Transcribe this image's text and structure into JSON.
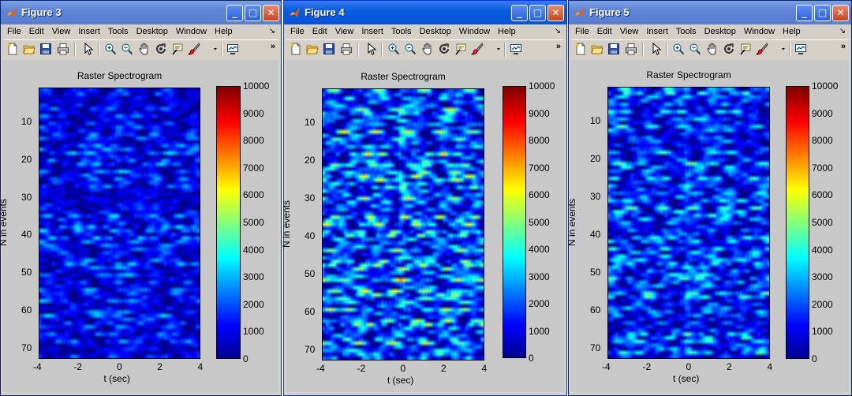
{
  "menu": [
    "File",
    "Edit",
    "View",
    "Insert",
    "Tools",
    "Desktop",
    "Window",
    "Help"
  ],
  "toolbar_icons": [
    "new-file-icon",
    "open-file-icon",
    "save-icon",
    "print-icon",
    "select-arrow-icon",
    "zoom-in-icon",
    "zoom-out-icon",
    "pan-hand-icon",
    "rotate-3d-icon",
    "data-cursor-icon",
    "brush-icon",
    "brush-dropdown-icon",
    "link-plot-icon"
  ],
  "title_buttons": {
    "minimize": "_",
    "maximize": "□",
    "close": "✕"
  },
  "dock_glyph": "↘",
  "more_glyph": "»",
  "colors": {
    "active_title": "#0754d8",
    "inactive_title": "#5b7fcf",
    "figure_bg": "#c8c8c8"
  },
  "windows": [
    {
      "title": "Figure 3",
      "active": false,
      "seed": 3,
      "chart_data": {
        "type": "heatmap",
        "title": "Raster Spectrogram",
        "xlabel": "t (sec)",
        "ylabel": "N in events",
        "xlim": [
          -4,
          4
        ],
        "ylim": [
          1,
          73
        ],
        "xticks": [
          "-4",
          "-2",
          "0",
          "2",
          "4"
        ],
        "yticks": [
          "10",
          "20",
          "30",
          "40",
          "50",
          "60",
          "70"
        ],
        "colorbar": {
          "min": 0,
          "max": 10000,
          "ticks": [
            "10000",
            "9000",
            "8000",
            "7000",
            "6000",
            "5000",
            "4000",
            "3000",
            "2000",
            "1000",
            "0"
          ]
        },
        "colormap": "jet",
        "intensity": "low"
      }
    },
    {
      "title": "Figure 4",
      "active": true,
      "seed": 4,
      "chart_data": {
        "type": "heatmap",
        "title": "Raster Spectrogram",
        "xlabel": "t (sec)",
        "ylabel": "N in events",
        "xlim": [
          -4,
          4
        ],
        "ylim": [
          1,
          73
        ],
        "xticks": [
          "-4",
          "-2",
          "0",
          "2",
          "4"
        ],
        "yticks": [
          "10",
          "20",
          "30",
          "40",
          "50",
          "60",
          "70"
        ],
        "colorbar": {
          "min": 0,
          "max": 10000,
          "ticks": [
            "10000",
            "9000",
            "8000",
            "7000",
            "6000",
            "5000",
            "4000",
            "3000",
            "2000",
            "1000",
            "0"
          ]
        },
        "colormap": "jet",
        "intensity": "high"
      }
    },
    {
      "title": "Figure 5",
      "active": false,
      "seed": 5,
      "chart_data": {
        "type": "heatmap",
        "title": "Raster Spectrogram",
        "xlabel": "t (sec)",
        "ylabel": "N in events",
        "xlim": [
          -4,
          4
        ],
        "ylim": [
          1,
          73
        ],
        "xticks": [
          "-4",
          "-2",
          "0",
          "2",
          "4"
        ],
        "yticks": [
          "10",
          "20",
          "30",
          "40",
          "50",
          "60",
          "70"
        ],
        "colorbar": {
          "min": 0,
          "max": 10000,
          "ticks": [
            "10000",
            "9000",
            "8000",
            "7000",
            "6000",
            "5000",
            "4000",
            "3000",
            "2000",
            "1000",
            "0"
          ]
        },
        "colormap": "jet",
        "intensity": "medium"
      }
    }
  ]
}
